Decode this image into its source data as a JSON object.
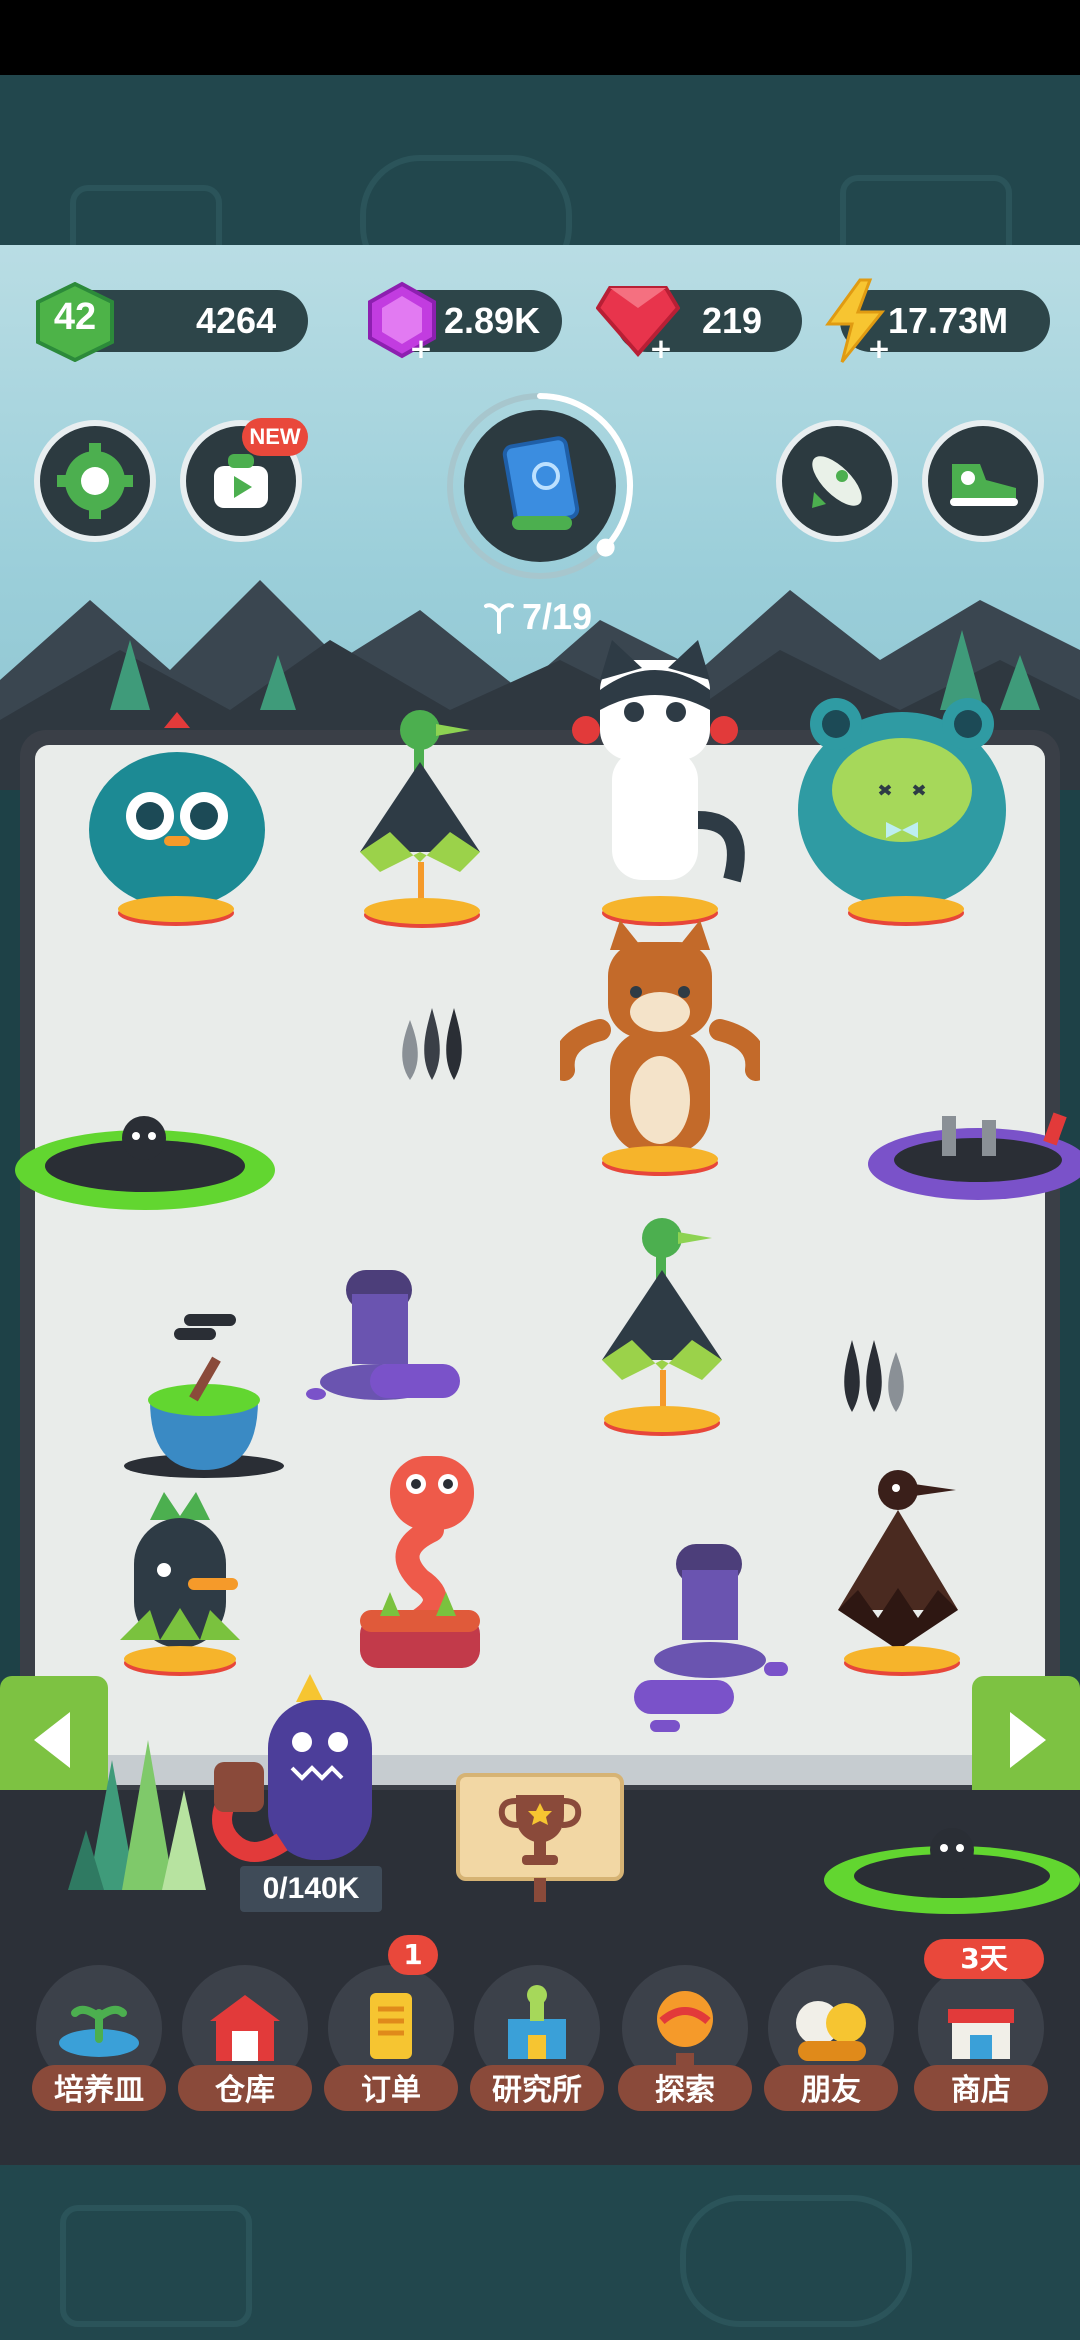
{
  "header": {
    "level": "42",
    "xp": "4264",
    "gems_purple": "2.89K",
    "rubies": "219",
    "energy": "17.73M"
  },
  "buttons": {
    "new_badge": "NEW"
  },
  "progress": {
    "text": "7/19",
    "fraction": 0.37
  },
  "lab": {
    "capacity": "0/140K"
  },
  "bottom_nav": [
    {
      "label": "培养皿",
      "icon": "sprout-icon"
    },
    {
      "label": "仓库",
      "icon": "barn-icon"
    },
    {
      "label": "订单",
      "icon": "scroll-icon",
      "badge": "1"
    },
    {
      "label": "研究所",
      "icon": "lab-icon"
    },
    {
      "label": "探索",
      "icon": "balloon-icon"
    },
    {
      "label": "朋友",
      "icon": "friends-icon"
    },
    {
      "label": "商店",
      "icon": "shop-icon",
      "badge": "3天"
    }
  ],
  "colors": {
    "accent_green": "#7dc242",
    "badge_red": "#e9483b",
    "label_brown": "#8a4a3a"
  }
}
